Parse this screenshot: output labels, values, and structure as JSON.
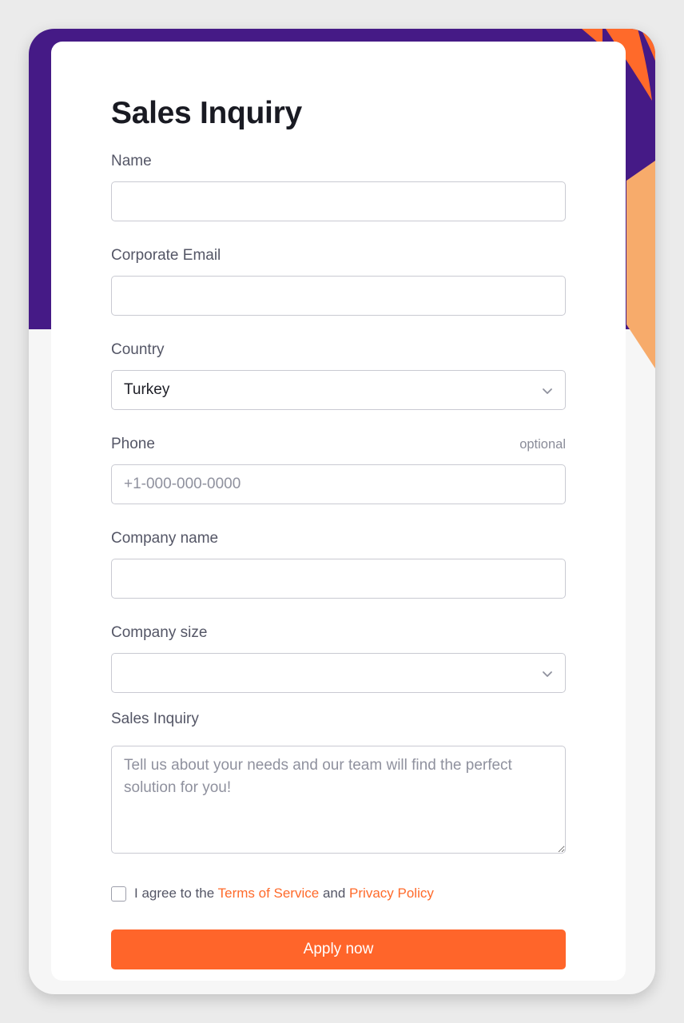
{
  "form": {
    "title": "Sales Inquiry",
    "name": {
      "label": "Name",
      "value": ""
    },
    "email": {
      "label": "Corporate Email",
      "value": ""
    },
    "country": {
      "label": "Country",
      "value": "Turkey"
    },
    "phone": {
      "label": "Phone",
      "optional_label": "optional",
      "placeholder": "+1-000-000-0000",
      "value": ""
    },
    "company_name": {
      "label": "Company name",
      "value": ""
    },
    "company_size": {
      "label": "Company size",
      "value": ""
    },
    "inquiry": {
      "label": "Sales Inquiry",
      "placeholder": "Tell us about your needs and our team will find the perfect solution for you!"
    },
    "agree": {
      "prefix": "I agree to the",
      "terms": "Terms of Service",
      "and": "and",
      "privacy": "Privacy Policy"
    },
    "submit_label": "Apply now"
  },
  "colors": {
    "accent": "#ff652a",
    "band": "#451a86",
    "peach": "#f7ab6b"
  },
  "icons": [
    "chevron-down-icon"
  ]
}
